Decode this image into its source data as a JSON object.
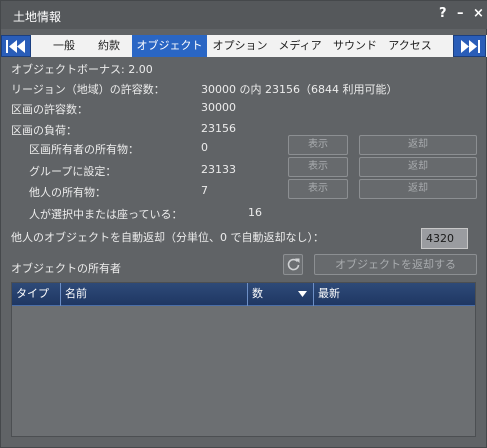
{
  "window": {
    "title": "土地情報",
    "help": "?",
    "minimize": "–",
    "close": "×"
  },
  "tabs": [
    {
      "label": "一般",
      "active": false
    },
    {
      "label": "約款",
      "active": false
    },
    {
      "label": "オブジェクト",
      "active": true
    },
    {
      "label": "オプション",
      "active": false
    },
    {
      "label": "メディア",
      "active": false
    },
    {
      "label": "サウンド",
      "active": false
    },
    {
      "label": "アクセス",
      "active": false
    }
  ],
  "objects": {
    "bonus": "オブジェクトボーナス: 2.00",
    "region_label": "リージョン（地域）の許容数：",
    "region_value": "30000 の内 23156（6844 利用可能）",
    "parcel_capacity_label": "区画の許容数：",
    "parcel_capacity_value": "30000",
    "parcel_load_label": "区画の負荷：",
    "parcel_load_value": "23156",
    "owner_label": "区画所有者の所有物：",
    "owner_value": "0",
    "group_label": "グループに設定：",
    "group_value": "23133",
    "others_label": "他人の所有物：",
    "others_value": "7",
    "selected_label": "人が選択中または座っている：",
    "selected_value": "16",
    "autoreturn_label": "他人のオブジェクトを自動返却（分単位、0 で自動返却なし）：",
    "autoreturn_value": "4320",
    "owners_section": "オブジェクトの所有者",
    "show_button": "表示",
    "return_button": "返却",
    "return_objects_button": "オブジェクトを返却する"
  },
  "table": {
    "columns": [
      "タイプ",
      "名前",
      "数",
      "最新"
    ]
  },
  "colors": {
    "accent": "#2a66c4",
    "panel": "#606366"
  }
}
